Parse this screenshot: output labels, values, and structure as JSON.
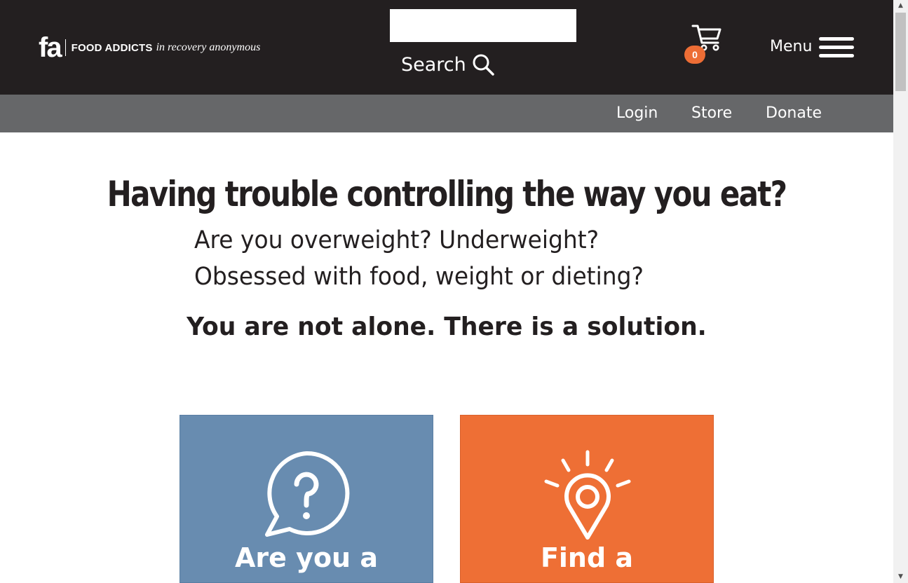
{
  "header": {
    "logo_mark": "fa",
    "logo_name": "FOOD ADDICTS",
    "logo_tagline": "in recovery anonymous",
    "search_value": "",
    "search_label": "Search",
    "cart_count": "0",
    "menu_label": "Menu"
  },
  "subnav": {
    "items": [
      {
        "label": "Login"
      },
      {
        "label": "Store"
      },
      {
        "label": "Donate"
      }
    ]
  },
  "hero": {
    "headline": "Having trouble controlling the way you eat?",
    "line1": "Are you overweight? Underweight?",
    "line2": "Obsessed with food, weight or dieting?",
    "tagline": "You are not alone. There is a solution."
  },
  "tiles": [
    {
      "title": "Are you a",
      "icon": "question-bubble-icon",
      "color": "#688cb0"
    },
    {
      "title": "Find a",
      "icon": "location-pin-icon",
      "color": "#ee6f35"
    }
  ],
  "colors": {
    "header_bg": "#231f20",
    "subnav_bg": "#666769",
    "accent": "#ed6d35"
  }
}
